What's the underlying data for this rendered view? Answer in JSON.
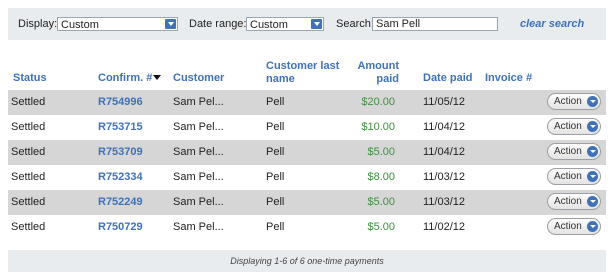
{
  "filters": {
    "display_label": "Display:",
    "display_value": "Custom",
    "date_range_label": "Date range:",
    "date_range_value": "Custom",
    "search_label": "Search:",
    "search_value": "Sam Pell",
    "clear_search": "clear search"
  },
  "table": {
    "headers": {
      "status": "Status",
      "confirm": "Confirm. #",
      "customer": "Customer",
      "last_name": "Customer last name",
      "amount": "Amount paid",
      "date": "Date paid",
      "invoice": "Invoice #"
    },
    "rows": [
      {
        "status": "Settled",
        "confirm": "R754996",
        "customer": "Sam Pel...",
        "last_name": "Pell",
        "amount": "$20.00",
        "date": "11/05/12",
        "invoice": "",
        "action": "Action"
      },
      {
        "status": "Settled",
        "confirm": "R753715",
        "customer": "Sam Pel...",
        "last_name": "Pell",
        "amount": "$10.00",
        "date": "11/04/12",
        "invoice": "",
        "action": "Action"
      },
      {
        "status": "Settled",
        "confirm": "R753709",
        "customer": "Sam Pel...",
        "last_name": "Pell",
        "amount": "$5.00",
        "date": "11/04/12",
        "invoice": "",
        "action": "Action"
      },
      {
        "status": "Settled",
        "confirm": "R752334",
        "customer": "Sam Pel...",
        "last_name": "Pell",
        "amount": "$8.00",
        "date": "11/03/12",
        "invoice": "",
        "action": "Action"
      },
      {
        "status": "Settled",
        "confirm": "R752249",
        "customer": "Sam Pel...",
        "last_name": "Pell",
        "amount": "$5.00",
        "date": "11/03/12",
        "invoice": "",
        "action": "Action"
      },
      {
        "status": "Settled",
        "confirm": "R750729",
        "customer": "Sam Pel...",
        "last_name": "Pell",
        "amount": "$5.00",
        "date": "11/02/12",
        "invoice": "",
        "action": "Action"
      }
    ]
  },
  "footer": {
    "text": "Displaying 1-6 of 6 one-time payments"
  },
  "colors": {
    "accent": "#3f72b8",
    "amount": "#3f8f3f",
    "row_alt": "#d6d6d6",
    "bar_bg": "#e9ecef"
  },
  "icons": {
    "select_arrow": "chevron-down-icon",
    "action_arrow": "chevron-down-icon",
    "sort": "sort-desc-icon"
  }
}
